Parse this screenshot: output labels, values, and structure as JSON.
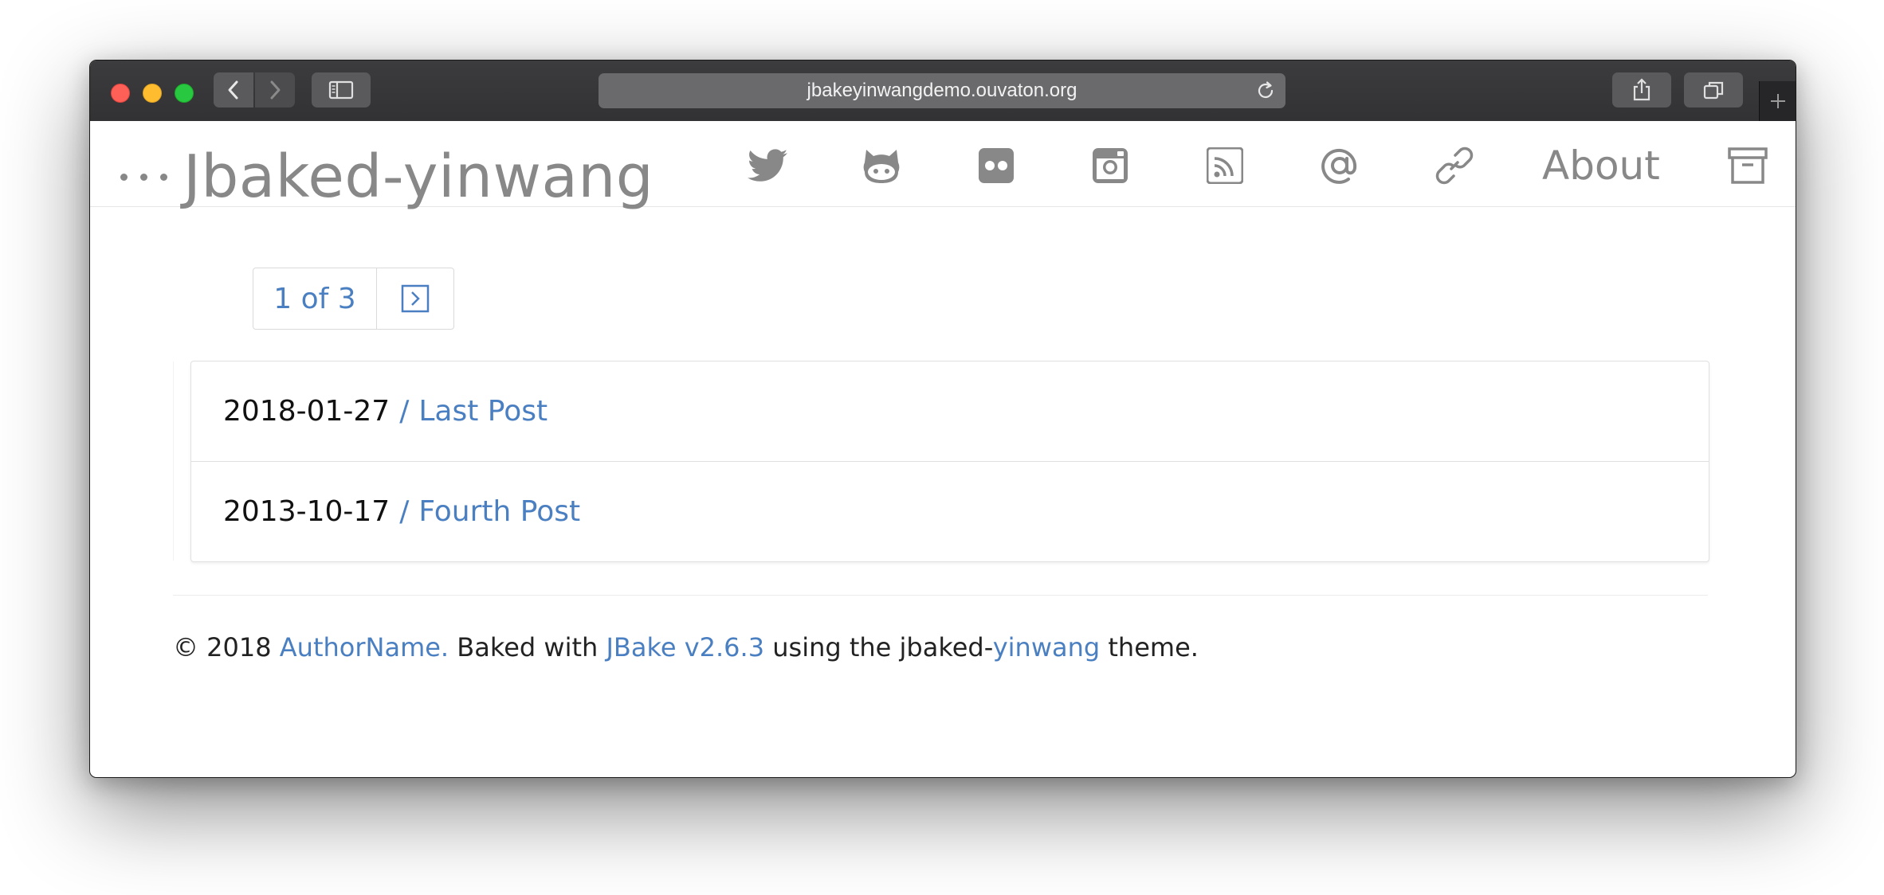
{
  "browser": {
    "url": "jbakeyinwangdemo.ouvaton.org"
  },
  "site": {
    "title": "Jbaked-yinwang",
    "nav": {
      "icons": [
        "twitter-icon",
        "github-icon",
        "flickr-icon",
        "instagram-icon",
        "rss-icon",
        "email-icon",
        "link-icon",
        "archive-icon"
      ],
      "about_label": "About"
    }
  },
  "pager": {
    "label": "1 of 3"
  },
  "posts": [
    {
      "date": "2018-01-27",
      "separator": "/",
      "title": "Last Post"
    },
    {
      "date": "2013-10-17",
      "separator": "/",
      "title": "Fourth Post"
    }
  ],
  "footer": {
    "copyright": "© 2018 ",
    "author": "AuthorName.",
    "baked_with": " Baked with ",
    "jbake": "JBake v2.6.3",
    "using": " using the jbaked-",
    "theme_link": "yinwang",
    "theme_suffix": " theme."
  },
  "colors": {
    "link": "#4a7fc1",
    "muted": "#888888",
    "toolbar": "#3c3c3e"
  }
}
